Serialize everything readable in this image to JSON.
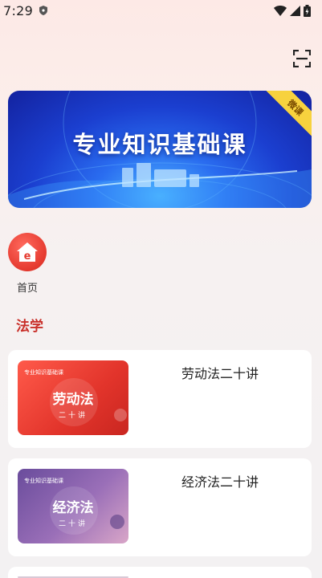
{
  "status": {
    "time": "7:29"
  },
  "banner": {
    "title": "专业知识基础课",
    "ribbon": "微课"
  },
  "nav": {
    "home_label": "首页"
  },
  "section": {
    "title": "法学"
  },
  "courses": [
    {
      "title": "劳动法二十讲",
      "thumb_title": "劳动法",
      "thumb_sub": "二十讲",
      "thumb_top": "专业知识基础课"
    },
    {
      "title": "经济法二十讲",
      "thumb_title": "经济法",
      "thumb_sub": "二十讲",
      "thumb_top": "专业知识基础课"
    }
  ],
  "colors": {
    "accent": "#c9302a",
    "banner_blue": "#1b3fd0",
    "card1": "#e5392e",
    "card2": "#7a5aa8"
  }
}
